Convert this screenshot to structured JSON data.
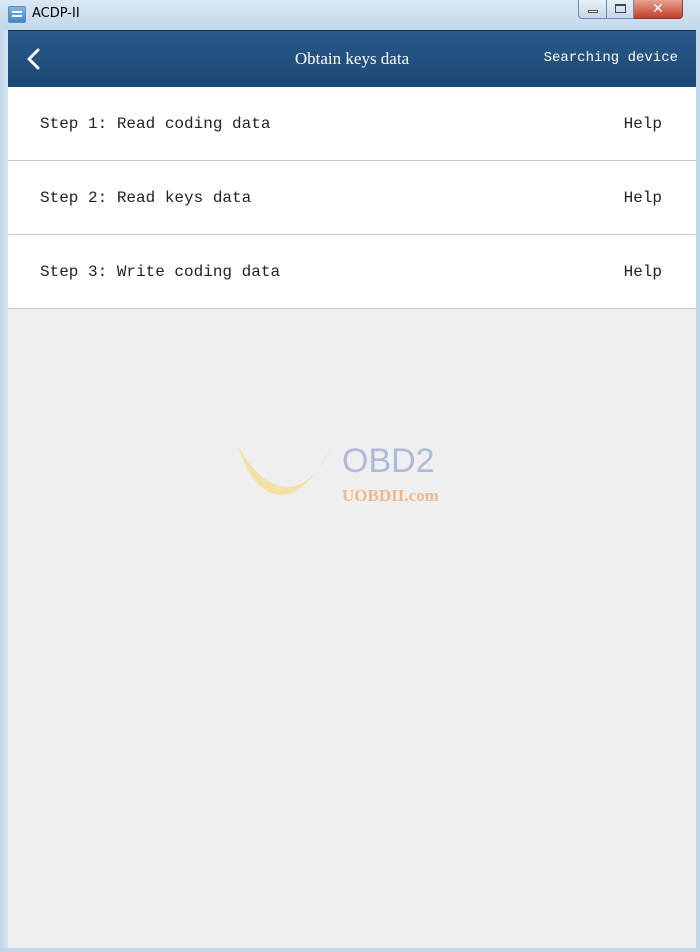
{
  "window": {
    "title": "ACDP-II",
    "icon": "app-icon",
    "controls": [
      "minimize",
      "maximize",
      "close"
    ],
    "close_glyph": "✕"
  },
  "header": {
    "back_icon": "chevron-left-icon",
    "title": "Obtain keys data",
    "status": "Searching device"
  },
  "steps": [
    {
      "label": "Step 1: Read coding data",
      "help": "Help"
    },
    {
      "label": "Step 2: Read keys data",
      "help": "Help"
    },
    {
      "label": "Step 3: Write coding data",
      "help": "Help"
    }
  ],
  "watermark": {
    "brand": "OBD2",
    "domain": "UOBDII.com"
  },
  "colors": {
    "header_bg": "#1f4d7c",
    "content_bg": "#efefef",
    "row_bg": "#ffffff",
    "watermark_brand": "#7a8fc8",
    "watermark_domain": "#f08a3c",
    "watermark_mark": "#f5d76e"
  }
}
